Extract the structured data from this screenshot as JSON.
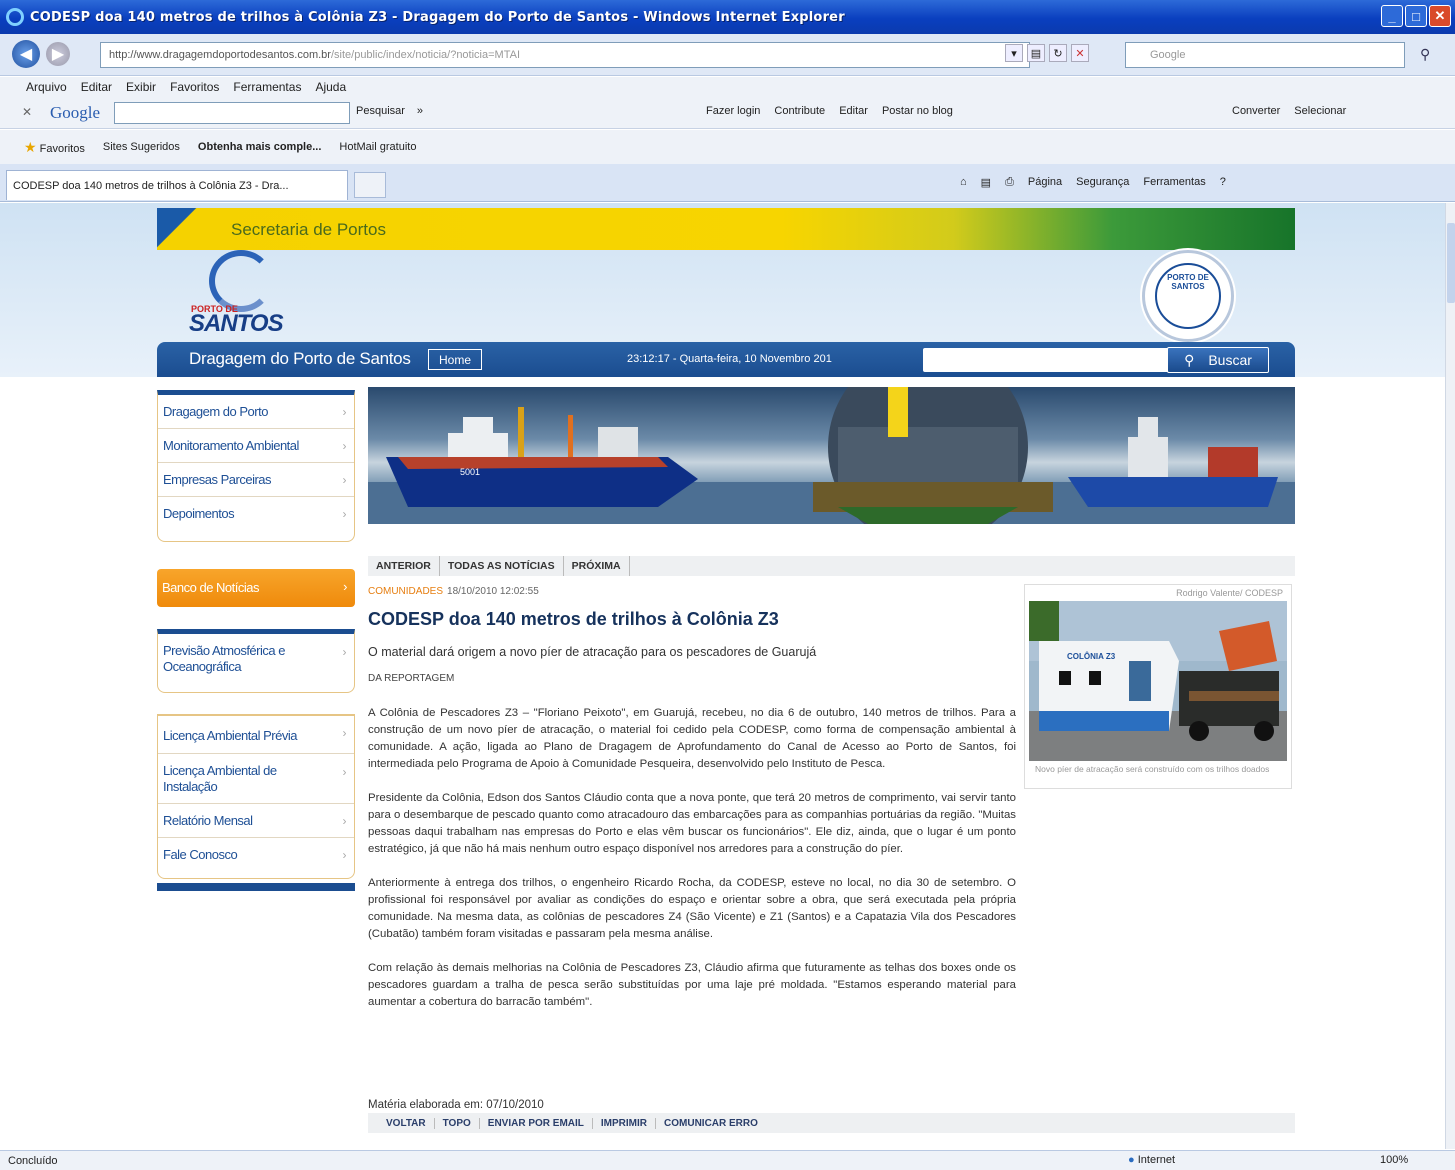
{
  "window": {
    "title": "CODESP doa 140 metros de trilhos à Colônia Z3 - Dragagem do Porto de Santos - Windows Internet Explorer"
  },
  "address": {
    "url_host": "http://www.dragagemdoportodesantos.com.br",
    "url_path": "/site/public/index/noticia/?noticia=MTAI",
    "search_placeholder": "Google"
  },
  "menubar": [
    "Arquivo",
    "Editar",
    "Exibir",
    "Favoritos",
    "Ferramentas",
    "Ajuda"
  ],
  "google_toolbar": {
    "logo": "Google",
    "items": [
      "Pesquisar",
      "»"
    ],
    "items2": [
      "Fazer login",
      "Contribute",
      "Editar",
      "Postar no blog"
    ],
    "items3": [
      "Converter",
      "Selecionar"
    ]
  },
  "favorites_bar": {
    "favorites": "Favoritos",
    "sites": "Sites Sugeridos",
    "get_more": "Obtenha mais comple...",
    "hotmail": "HotMail gratuito"
  },
  "tab": {
    "label": "CODESP doa 140 metros de trilhos à Colônia Z3 - Dra...",
    "commands": [
      "Página",
      "Segurança",
      "Ferramentas"
    ]
  },
  "site": {
    "secretaria": "Secretaria de Portos",
    "logo_porto": "PORTO DE",
    "logo_santos": "SANTOS",
    "brand": "Dragagem do Porto de Santos",
    "home": "Home",
    "datetime": "23:12:17 - Quarta-feira, 10 Novembro 201",
    "search_button": "Buscar",
    "seal_text": "PORTO DE SANTOS"
  },
  "menu": {
    "group1": [
      "Dragagem do Porto",
      "Monitoramento Ambiental",
      "Empresas Parceiras",
      "Depoimentos"
    ],
    "banco": "Banco de Notícias",
    "group2": [
      "Previsão Atmosférica e Oceanográfica"
    ],
    "group3": [
      "Licença Ambiental Prévia",
      "Licença Ambiental de Instalação",
      "Relatório Mensal",
      "Fale Conosco"
    ]
  },
  "article_nav": [
    "ANTERIOR",
    "TODAS AS NOTÍCIAS",
    "PRÓXIMA"
  ],
  "article": {
    "category": "COMUNIDADES",
    "datetime": "18/10/2010 12:02:55",
    "headline": "CODESP doa 140 metros de trilhos à Colônia Z3",
    "subtitle": "O material dará origem a novo píer de atracação para os pescadores de Guarujá",
    "byline": "DA REPORTAGEM",
    "paragraphs": [
      "A Colônia de Pescadores Z3 – \"Floriano Peixoto\", em Guarujá, recebeu, no dia 6 de outubro, 140 metros de trilhos. Para a construção de um novo píer de atracação, o material foi cedido pela CODESP, como forma de compensação ambiental à comunidade. A ação, ligada ao Plano de Dragagem de Aprofundamento do Canal de Acesso ao Porto de Santos, foi intermediada pelo Programa de Apoio à Comunidade Pesqueira, desenvolvido pelo Instituto de Pesca.",
      "Presidente da Colônia, Edson dos Santos Cláudio conta que a nova ponte, que terá 20 metros de comprimento, vai servir tanto para o desembarque de pescado quanto como atracadouro das embarcações para as companhias portuárias da região. \"Muitas pessoas daqui trabalham nas empresas do Porto e elas vêm buscar os funcionários\". Ele diz, ainda, que o lugar é um ponto estratégico, já que não há mais nenhum outro espaço disponível nos arredores para a construção do píer.",
      "Anteriormente à entrega dos trilhos, o engenheiro Ricardo Rocha, da CODESP, esteve no local, no dia 30 de setembro. O profissional foi responsável por avaliar as condições do espaço e orientar sobre a obra, que será executada pela própria comunidade. Na mesma data, as colônias de pescadores Z4 (São Vicente) e Z1 (Santos) e a Capatazia Vila dos Pescadores (Cubatão) também foram visitadas e passaram pela mesma análise.",
      "Com relação às demais melhorias na Colônia de Pescadores Z3, Cláudio afirma que futuramente as telhas dos boxes onde os pescadores guardam a tralha de pesca serão substituídas por uma laje pré moldada. \"Estamos esperando material para aumentar a cobertura do barracão também\"."
    ],
    "footnote": "Matéria elaborada em: 07/10/2010",
    "photo_credit": "Rodrigo Valente/ CODESP",
    "photo_caption": "Novo píer de atracação será construído com os trilhos doados",
    "photo_sign": "COLÔNIA Z3"
  },
  "actions": [
    "VOLTAR",
    "TOPO",
    "ENVIAR POR EMAIL",
    "IMPRIMIR",
    "COMUNICAR ERRO"
  ],
  "status": {
    "text": "Concluído",
    "zone": "Internet",
    "zoom": "100%"
  }
}
